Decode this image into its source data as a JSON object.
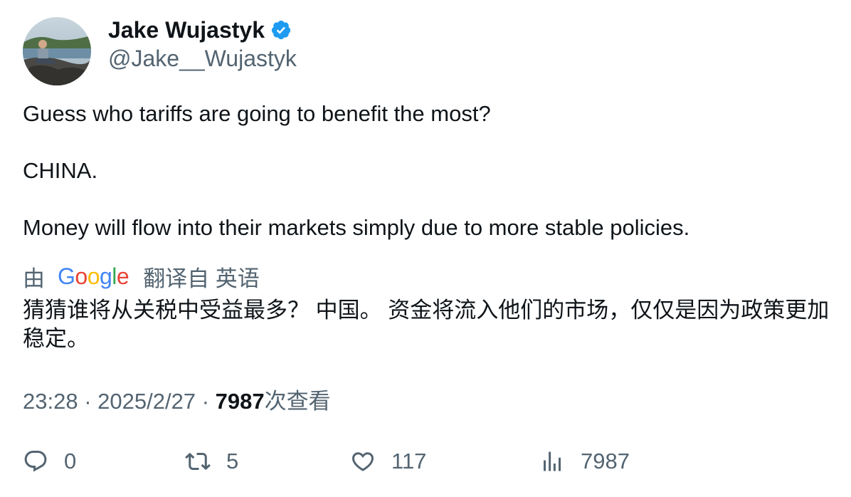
{
  "author": {
    "name": "Jake Wujastyk",
    "handle": "@Jake__Wujastyk",
    "verified_color": "#1d9bf0"
  },
  "tweet": {
    "lines": [
      "Guess who tariffs are going to benefit the most?",
      "CHINA.",
      "Money will flow into their markets simply due to more stable policies."
    ]
  },
  "translation": {
    "by_label": "由",
    "provider_letters": [
      "G",
      "o",
      "o",
      "g",
      "l",
      "e"
    ],
    "provider_colors": [
      "#4285F4",
      "#EA4335",
      "#FBBC05",
      "#4285F4",
      "#34A853",
      "#EA4335"
    ],
    "translated_from": "翻译自 英语",
    "text": "猜猜谁将从关税中受益最多？ 中国。 资金将流入他们的市场，仅仅是因为政策更加稳定。"
  },
  "meta": {
    "time": "23:28",
    "date": "2025/2/27",
    "views_count": "7987",
    "views_label": "次查看"
  },
  "actions": {
    "replies": "0",
    "retweets": "5",
    "likes": "117",
    "views": "7987"
  },
  "icons": {
    "reply": "reply-icon",
    "retweet": "retweet-icon",
    "like": "heart-icon",
    "analytics": "analytics-icon"
  }
}
